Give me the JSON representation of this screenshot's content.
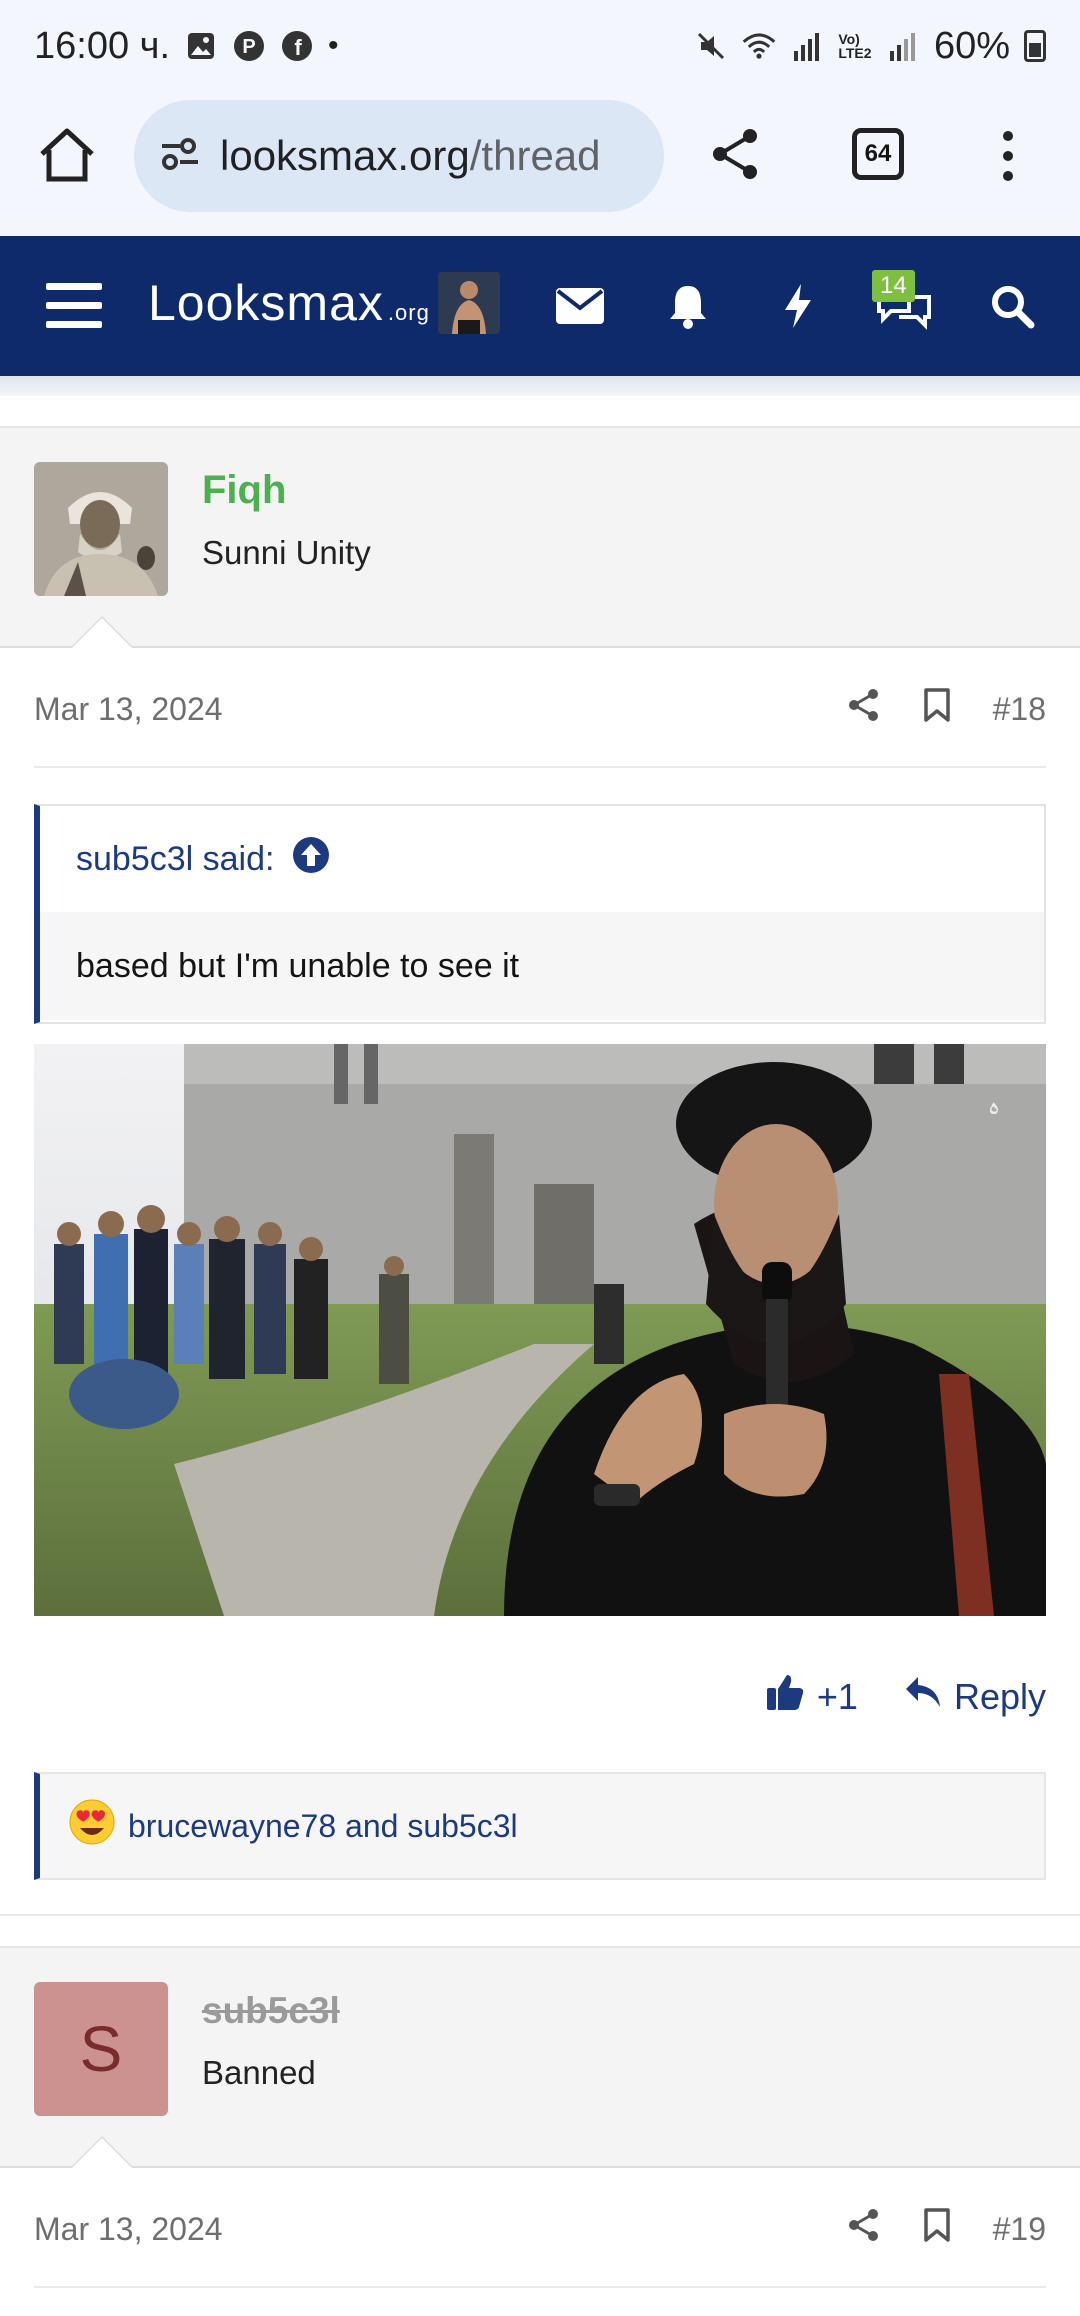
{
  "status_bar": {
    "time": "16:00 ч.",
    "battery": "60%"
  },
  "browser": {
    "url_domain": "looksmax.org",
    "url_path": "/thread",
    "tab_count": "64"
  },
  "site_nav": {
    "logo_text": "Looksmax",
    "logo_suffix": ".org",
    "chat_badge": "14"
  },
  "post1": {
    "username": "Fiqh",
    "user_title": "Sunni Unity",
    "date": "Mar 13, 2024",
    "post_number": "#18",
    "quote_author": "sub5c3l said:",
    "quote_text": "based but I'm unable to see it",
    "like_count": "+1",
    "reply_label": "Reply",
    "reactions_text": "brucewayne78 and sub5c3l"
  },
  "post2": {
    "avatar_letter": "S",
    "username": "sub5c3l",
    "user_title": "Banned",
    "date": "Mar 13, 2024",
    "post_number": "#19"
  },
  "colors": {
    "nav_bg": "#0e2a6b",
    "accent_blue": "#1e3a7e",
    "username_color": "#47a7eb",
    "badge_green": "#7fbf3f"
  }
}
